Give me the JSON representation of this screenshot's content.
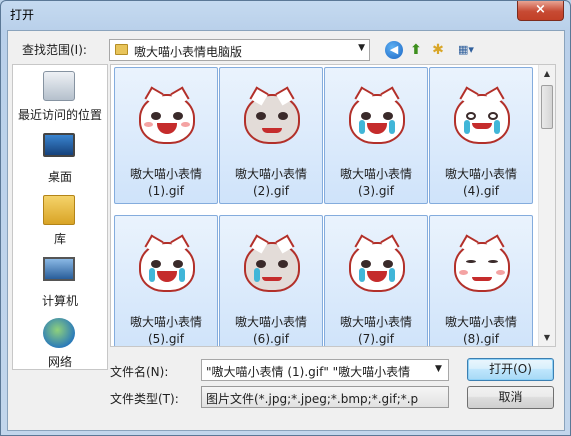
{
  "window": {
    "title": "打开",
    "close_glyph": "×"
  },
  "toolbar": {
    "lookin_label": "查找范围(I):",
    "lookin_value": "嗷大喵小表情电脑版",
    "back_glyph": "◀",
    "up_glyph": "⬆",
    "newfolder_glyph": "✱",
    "views_glyph": "▦▾"
  },
  "places": [
    {
      "label": "最近访问的位置",
      "icon": "recent-places-icon"
    },
    {
      "label": "桌面",
      "icon": "desktop-icon"
    },
    {
      "label": "库",
      "icon": "libraries-icon"
    },
    {
      "label": "计算机",
      "icon": "computer-icon"
    },
    {
      "label": "网络",
      "icon": "network-icon"
    }
  ],
  "files": [
    {
      "line1": "嗷大喵小表情",
      "line2": "(1).gif"
    },
    {
      "line1": "嗷大喵小表情",
      "line2": "(2).gif"
    },
    {
      "line1": "嗷大喵小表情",
      "line2": "(3).gif"
    },
    {
      "line1": "嗷大喵小表情",
      "line2": "(4).gif"
    },
    {
      "line1": "嗷大喵小表情",
      "line2": "(5).gif"
    },
    {
      "line1": "嗷大喵小表情",
      "line2": "(6).gif"
    },
    {
      "line1": "嗷大喵小表情",
      "line2": "(7).gif"
    },
    {
      "line1": "嗷大喵小表情",
      "line2": "(8).gif"
    }
  ],
  "footer": {
    "filename_label": "文件名(N):",
    "filename_value": "\"嗷大喵小表情 (1).gif\" \"嗷大喵小表情",
    "filetype_label": "文件类型(T):",
    "filetype_value": "图片文件(*.jpg;*.jpeg;*.bmp;*.gif;*.p",
    "open_label": "打开(O)",
    "cancel_label": "取消"
  },
  "scrollbar": {
    "up_glyph": "▲",
    "down_glyph": "▼"
  },
  "colors": {
    "selection": "#cfe3fa",
    "selection_border": "#84acdd",
    "title_bar": "#b9d0ea",
    "close_red": "#c74a33"
  }
}
